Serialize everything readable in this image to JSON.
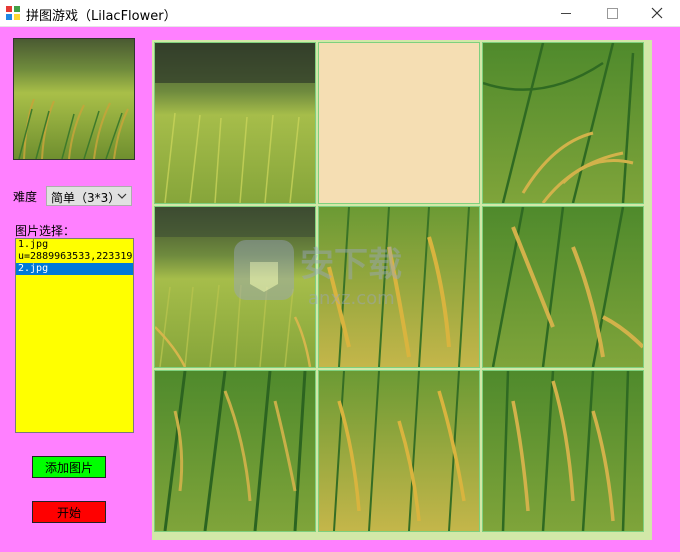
{
  "window": {
    "title": "拼图游戏（LilacFlower）"
  },
  "controls": {
    "difficulty_label": "难度",
    "difficulty_value": "简单（3*3）",
    "picture_label": "图片选择：",
    "files": [
      "1.jpg",
      "u=2889963533,223319",
      "2.jpg"
    ],
    "selected_index": 2,
    "add_button": "添加图片",
    "start_button": "开始"
  },
  "board": {
    "size": "3*3",
    "blank_position": 1
  },
  "watermark": {
    "text": "安下载",
    "domain": "anxz.com"
  }
}
